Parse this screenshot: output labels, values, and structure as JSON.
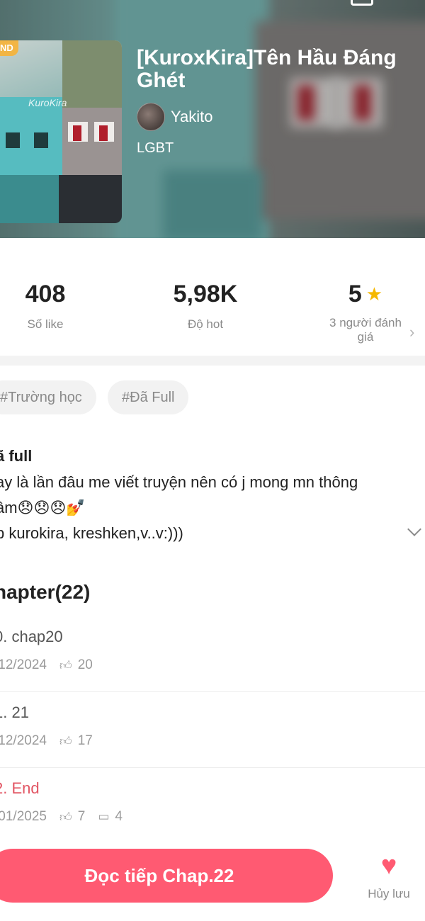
{
  "book": {
    "badge": "ND",
    "cover_watermark": "KuroKira",
    "title": "[KuroxKira]Tên Hầu Đáng Ghét",
    "author": "Yakito",
    "genre": "LGBT"
  },
  "stats": {
    "likes": {
      "value": "408",
      "label": "Số like"
    },
    "hot": {
      "value": "5,98K",
      "label": "Độ hot"
    },
    "rating": {
      "value": "5",
      "label_line1": "3 người đánh",
      "label_line2": "giá"
    }
  },
  "tags": [
    "#Trường học",
    "#Đã Full"
  ],
  "description": {
    "status": "ã full",
    "line1": "ay là lần đâu me viết truyện nên có j mong mn thông",
    "line2": "âm😞😞😞💅",
    "line3": "p kurokira, kreshken,v..v:)))"
  },
  "chapters_heading": "hapter(22)",
  "chapters": [
    {
      "title": "0. chap20",
      "date": "/12/2024",
      "likes": "20",
      "comments": ""
    },
    {
      "title": "1. 21",
      "date": "/12/2024",
      "likes": "17",
      "comments": ""
    },
    {
      "title": "2. End",
      "date": "/01/2025",
      "likes": "7",
      "comments": "4"
    }
  ],
  "bottom": {
    "read_button": "Đọc tiếp Chap.22",
    "save_label": "Hủy lưu"
  },
  "colors": {
    "accent": "#ff5a72",
    "active_chapter": "#e25563",
    "star": "#f5b800",
    "badge": "#f2b544"
  }
}
